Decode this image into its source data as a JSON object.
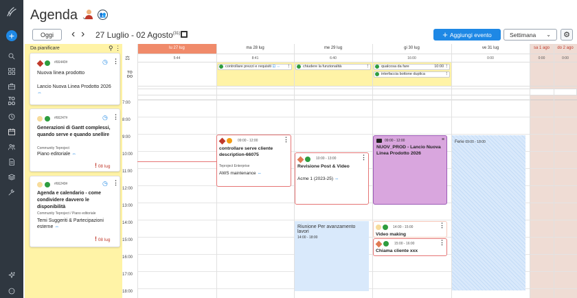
{
  "app": {
    "title": "Agenda",
    "title_chevron": "⌄"
  },
  "colors": {
    "sidebar": "#2f3740",
    "accent": "#1e88e5",
    "today": "#f08a6a",
    "weekend": "#efdcd4",
    "unscheduled_bg": "#fff3a6",
    "card_border": "#e57373",
    "purple": "#d9a6de",
    "light_blue": "#d9e9fb"
  },
  "sidebar": {
    "icons": [
      "logo-icon",
      "add-icon",
      "search-icon",
      "dashboard-icon",
      "briefcase-icon",
      "todo-icon",
      "clock-icon",
      "calendar-icon",
      "users-icon",
      "document-icon",
      "stack-icon",
      "tools-icon",
      "sparkle-icon",
      "chat-icon"
    ]
  },
  "toolbar": {
    "today": "Oggi",
    "prev": "‹",
    "next": "›",
    "range": "27 Luglio - 02 Agosto",
    "week_num": "(31)",
    "add_event": "Aggiungi evento",
    "view": "Settimana",
    "settings": "⚙"
  },
  "unscheduled": {
    "title": "Da pianificare",
    "cards": [
      {
        "id": "#66440#",
        "title": "Nuova linea prodotto",
        "project": "Lancio Nuova Linea Prodotto 2026",
        "link": "⇔",
        "due": "",
        "org": ""
      },
      {
        "id": "#66247#",
        "title": "Generazioni di Gantt complessi, quando serve e quando snellire",
        "org": "Community Teproject",
        "project": "Piano editoriale",
        "link": "⇔",
        "due": "08 lug"
      },
      {
        "id": "#66249#",
        "title": "Agenda e calendario - come condividere davvero le disponibilità",
        "org": "Community Teproject / Piano editoriale",
        "project": "Temi Suggeriti & Partecipazioni esterne",
        "link": "⇔",
        "due": "08 lug"
      }
    ]
  },
  "days": [
    {
      "label": "lu 27 lug",
      "hours": "5:44"
    },
    {
      "label": "ma 28 lug",
      "hours": "8:41"
    },
    {
      "label": "me 29 lug",
      "hours": "6:40"
    },
    {
      "label": "gi 30 lug",
      "hours": "16:00"
    },
    {
      "label": "ve 31 lug",
      "hours": "0:00"
    },
    {
      "label": "sa 1 ago",
      "hours": "0:00"
    },
    {
      "label": "do 2 ago",
      "hours": "0:00"
    }
  ],
  "allday_label": "TO DO",
  "todos": [
    {
      "text": "controllare prezzi e requisiti",
      "badge": "⊡ ⇔"
    },
    {
      "text": "chiudere la funzionalità"
    },
    {
      "text": "qualcosa da fare",
      "time": "10:00"
    },
    {
      "text": "interfaccia bottone duplica"
    }
  ],
  "hours": [
    "7:00",
    "8:00",
    "9:00",
    "10:00",
    "11:00",
    "12:00",
    "13:00",
    "14:00",
    "15:00",
    "16:00",
    "17:00",
    "18:00"
  ],
  "events": [
    {
      "time": "09:00 - 12:00",
      "title": "controllare serve cliente description-66075",
      "org": "Teproject Enterprise",
      "project": "AWS maintenance",
      "link": "⇔"
    },
    {
      "time": "10:00 - 13:00",
      "title": "Revisione Post & Video",
      "project": "Acme 1 (2023-25)",
      "link": "⇔"
    },
    {
      "time": "09:00 - 12:00",
      "title": "NUOV_PROD - Lancio Nuova Linea Prodotto 2026"
    },
    {
      "time": "09:00 - 18:00",
      "title": "Ferie"
    },
    {
      "time": "14:00 - 18:00",
      "title": "Riunione Per avanzamento lavori"
    },
    {
      "time": "14:00 - 15:00",
      "title": "Video making"
    },
    {
      "time": "15:00 - 16:00",
      "title": "Chiama cliente xxx"
    }
  ]
}
